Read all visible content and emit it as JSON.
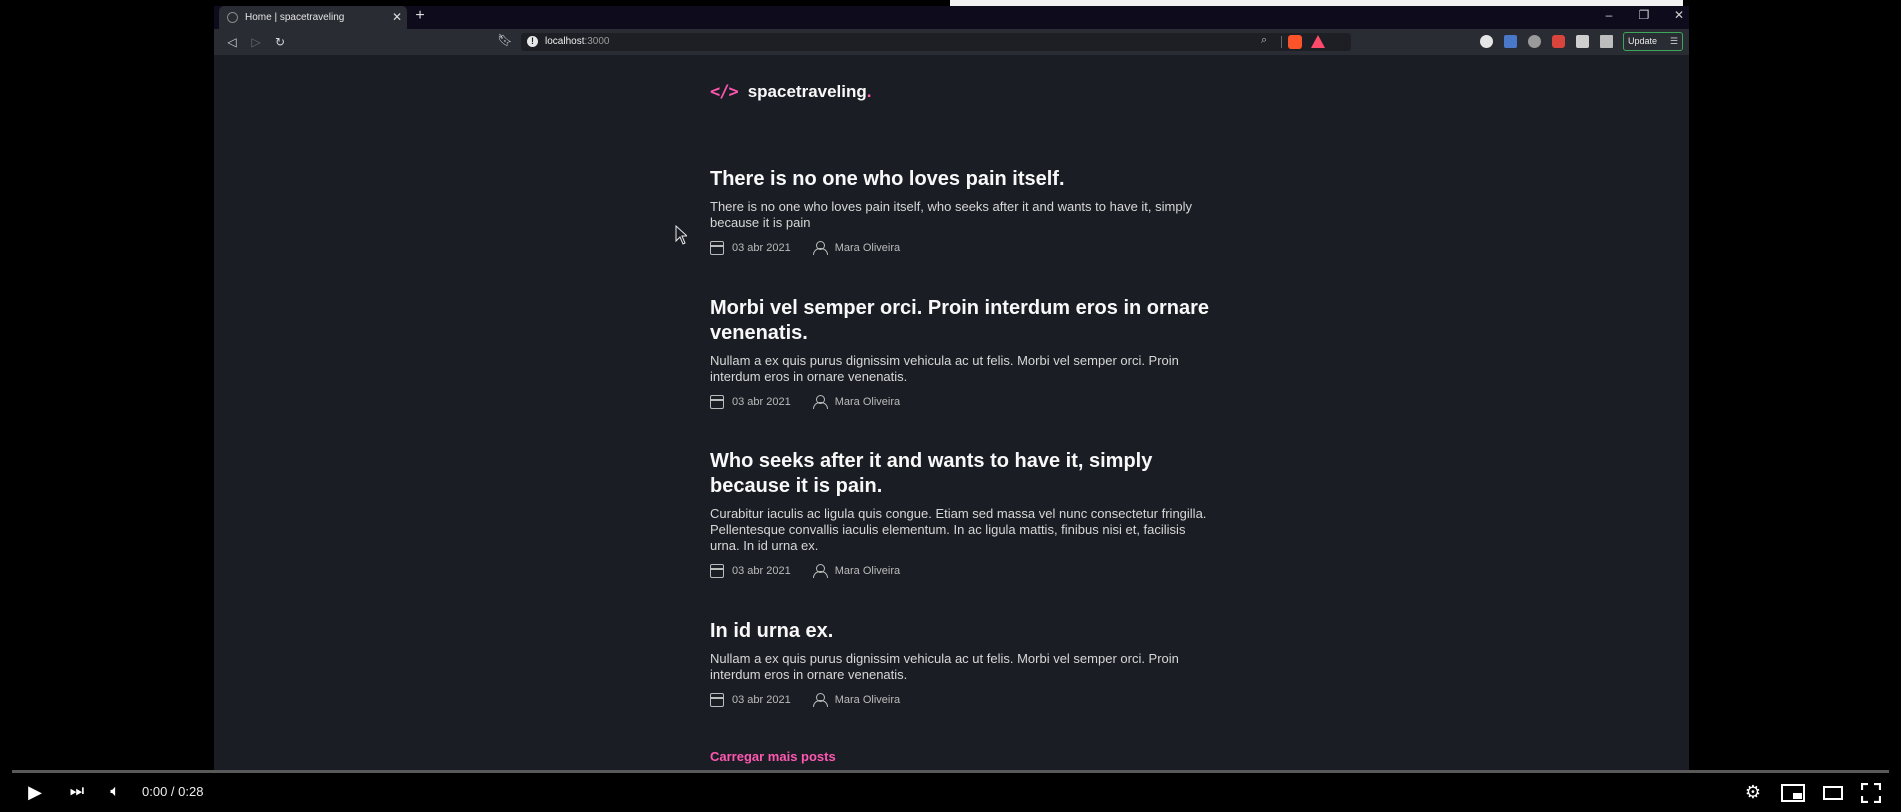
{
  "browser": {
    "tab_title": "Home | spacetraveling",
    "url_host": "localhost",
    "url_port": ":3000",
    "update_label": "Update"
  },
  "site": {
    "logo_mark": "</>",
    "logo_name": "spacetraveling",
    "logo_dot": ".",
    "load_more": "Carregar mais posts"
  },
  "posts": [
    {
      "title": "There is no one who loves pain itself.",
      "subtitle": "There is no one who loves pain itself, who seeks after it and wants to have it, simply because it is pain",
      "date": "03 abr 2021",
      "author": "Mara Oliveira"
    },
    {
      "title": "Morbi vel semper orci. Proin interdum eros in ornare venenatis.",
      "subtitle": "Nullam a ex quis purus dignissim vehicula ac ut felis. Morbi vel semper orci. Proin interdum eros in ornare venenatis.",
      "date": "03 abr 2021",
      "author": "Mara Oliveira"
    },
    {
      "title": "Who seeks after it and wants to have it, simply because it is pain.",
      "subtitle": "Curabitur iaculis ac ligula quis congue. Etiam sed massa vel nunc consectetur fringilla. Pellentesque convallis iaculis elementum. In ac ligula mattis, finibus nisi et, facilisis urna. In id urna ex.",
      "date": "03 abr 2021",
      "author": "Mara Oliveira"
    },
    {
      "title": "In id urna ex.",
      "subtitle": "Nullam a ex quis purus dignissim vehicula ac ut felis. Morbi vel semper orci. Proin interdum eros in ornare venenatis.",
      "date": "03 abr 2021",
      "author": "Mara Oliveira"
    }
  ],
  "player": {
    "time": "0:00 / 0:28",
    "progress": 0
  },
  "colors": {
    "accent": "#ff57b2",
    "page_bg": "#1a1d23"
  }
}
